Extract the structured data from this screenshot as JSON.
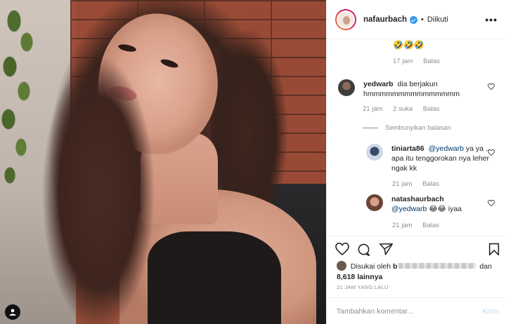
{
  "post": {
    "username": "nafaurbach",
    "follow_status": "Diikuti",
    "dot": "•",
    "more_icon": "more-horizontal-icon"
  },
  "comments": {
    "top_comment": {
      "emoji": "🤣🤣🤣",
      "time": "17 jam",
      "reply": "Balas"
    },
    "main_comment": {
      "username": "yedwarb",
      "text": "dia berjakun hmmmmmmmmmmmmmmm",
      "time": "21 jam",
      "likes": "2 suka",
      "reply": "Balas"
    },
    "hide_replies": "Sembunyikan balasan",
    "replies": [
      {
        "username": "tiniarta86",
        "mention": "@yedwarb",
        "text": "ya ya .. apa itu tenggorokan nya leher ngak kk",
        "time": "21 jam",
        "reply": "Balas"
      },
      {
        "username": "natashaurbach",
        "mention": "@yedwarb",
        "text": "😂😂 iyaa",
        "time": "21 jam",
        "reply": "Balas"
      }
    ]
  },
  "footer": {
    "liked_by_prefix": "Disukai oleh",
    "liked_by_user_start": "b",
    "liked_by_suffix": "dan",
    "others_count": "8,618 lainnya",
    "timestamp": "21 JAM YANG LALU",
    "comment_placeholder": "Tambahkan komentar...",
    "post_label": "Kirim"
  },
  "colors": {
    "verified": "#3897f0",
    "post_button_disabled": "#b2dffc",
    "meta_text": "#8e8e8e"
  }
}
